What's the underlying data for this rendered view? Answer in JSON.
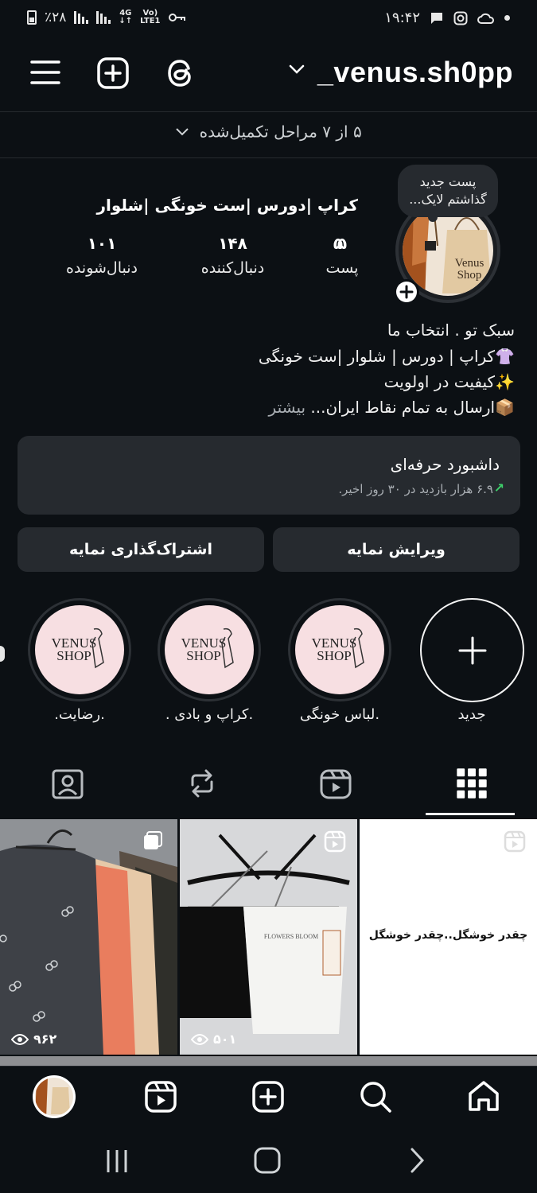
{
  "status_bar": {
    "battery_pct": "٪۲۸",
    "network": "4G",
    "volte_top": "Vo)",
    "volte_bottom": "LTE1",
    "time": "۱۹:۴۲"
  },
  "header": {
    "username": "_venus.sh0pp",
    "icons": [
      "menu-icon",
      "new-post-icon",
      "threads-icon",
      "chevron-down-icon"
    ]
  },
  "setup_steps": {
    "label": "۵ از ۷ مراحل تکمیل‌شده"
  },
  "profile": {
    "note_line1": "پست جدید",
    "note_line2": "گذاشتم لایک...",
    "name": "کراپ |دورس |ست خونگی |شلوار",
    "avatar_text_line1": "Venus",
    "avatar_text_line2": "Shop",
    "stats": {
      "posts": {
        "value": "۵",
        "label": "پست"
      },
      "followers": {
        "value": "۱۴۸",
        "label": "دنبال‌کننده"
      },
      "following": {
        "value": "۱۰۱",
        "label": "دنبال‌شونده"
      }
    },
    "bio_lines": [
      "سبک تو . انتخاب ما",
      "کراپ | دورس | شلوار |ست خونگی",
      "کیفیت در اولویت",
      "ارسال به تمام نقاط ایران..."
    ],
    "bio_more": "بیشتر"
  },
  "dashboard": {
    "title": "داشبورد حرفه‌ای",
    "subtitle": "۶.۹ هزار بازدید در ۳۰ روز اخیر."
  },
  "buttons": {
    "edit_profile": "ویرایش نمایه",
    "share_profile": "اشتراک‌گذاری نمایه"
  },
  "highlights": {
    "new_label": "جدید",
    "logo_line1": "VENUS",
    "logo_line2": "SHOP",
    "items": [
      {
        "label": ".لباس خونگی"
      },
      {
        "label": ".کراپ و بادی ."
      },
      {
        "label": ".رضایت."
      }
    ]
  },
  "tabs": [
    "grid-icon",
    "reels-icon",
    "reposts-icon",
    "tagged-icon"
  ],
  "grid": {
    "posts": [
      {
        "views": "۹۶۲",
        "type": "carousel"
      },
      {
        "views": "۵۰۱",
        "type": "reel",
        "tag_text": "FLOWERS BLOOM"
      },
      {
        "views": "",
        "type": "reel",
        "caption": "چقدر خوشگل..چقدر خوشگل"
      }
    ]
  },
  "bottom_nav": [
    "profile-avatar",
    "reels-icon",
    "create-icon",
    "search-icon",
    "home-icon"
  ],
  "system_nav": [
    "recents-icon",
    "home-button-icon",
    "back-icon"
  ]
}
